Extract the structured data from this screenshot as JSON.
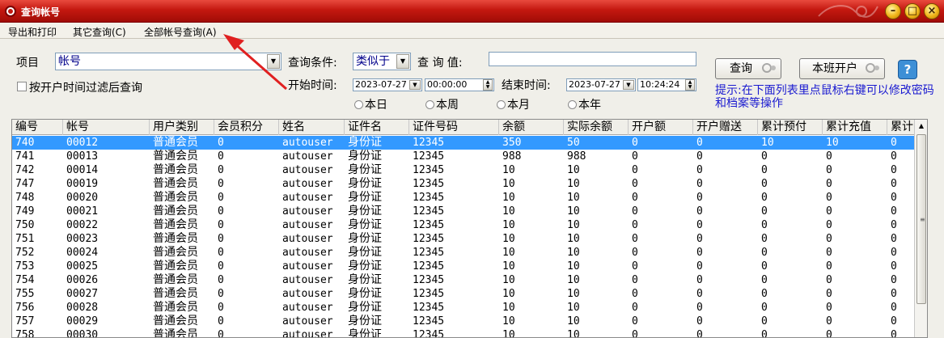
{
  "window": {
    "title": "查询帐号"
  },
  "menu": [
    "导出和打印",
    "其它查询(C)",
    "全部帐号查询(A)"
  ],
  "search": {
    "item_label": "项目",
    "item_value": "帐号",
    "condition_label": "查询条件:",
    "condition_value": "类似于",
    "query_value_label": "查 询 值:",
    "query_value": "",
    "filter_checkbox_label": "按开户时间过滤后查询",
    "start_time_label": "开始时间:",
    "start_date": "2023-07-27",
    "start_time": "00:00:00",
    "end_time_label": "结束时间:",
    "end_date": "2023-07-27",
    "end_time": "10:24:24",
    "ranges": [
      "本日",
      "本周",
      "本月",
      "本年"
    ]
  },
  "buttons": {
    "query": "查询",
    "open_shift": "本班开户",
    "help": "?"
  },
  "hint": "提示:在下面列表里点鼠标右键可以修改密码和档案等操作",
  "table": {
    "columns": [
      "编号",
      "帐号",
      "用户类别",
      "会员积分",
      "姓名",
      "证件名",
      "证件号码",
      "余额",
      "实际余额",
      "开户额",
      "开户赠送",
      "累计预付",
      "累计充值",
      "累计"
    ],
    "rows": [
      [
        "740",
        "00012",
        "普通会员",
        "0",
        "autouser",
        "身份证",
        "12345",
        "350",
        "50",
        "0",
        "0",
        "10",
        "10",
        "0"
      ],
      [
        "741",
        "00013",
        "普通会员",
        "0",
        "autouser",
        "身份证",
        "12345",
        "988",
        "988",
        "0",
        "0",
        "0",
        "0",
        "0"
      ],
      [
        "742",
        "00014",
        "普通会员",
        "0",
        "autouser",
        "身份证",
        "12345",
        "10",
        "10",
        "0",
        "0",
        "0",
        "0",
        "0"
      ],
      [
        "747",
        "00019",
        "普通会员",
        "0",
        "autouser",
        "身份证",
        "12345",
        "10",
        "10",
        "0",
        "0",
        "0",
        "0",
        "0"
      ],
      [
        "748",
        "00020",
        "普通会员",
        "0",
        "autouser",
        "身份证",
        "12345",
        "10",
        "10",
        "0",
        "0",
        "0",
        "0",
        "0"
      ],
      [
        "749",
        "00021",
        "普通会员",
        "0",
        "autouser",
        "身份证",
        "12345",
        "10",
        "10",
        "0",
        "0",
        "0",
        "0",
        "0"
      ],
      [
        "750",
        "00022",
        "普通会员",
        "0",
        "autouser",
        "身份证",
        "12345",
        "10",
        "10",
        "0",
        "0",
        "0",
        "0",
        "0"
      ],
      [
        "751",
        "00023",
        "普通会员",
        "0",
        "autouser",
        "身份证",
        "12345",
        "10",
        "10",
        "0",
        "0",
        "0",
        "0",
        "0"
      ],
      [
        "752",
        "00024",
        "普通会员",
        "0",
        "autouser",
        "身份证",
        "12345",
        "10",
        "10",
        "0",
        "0",
        "0",
        "0",
        "0"
      ],
      [
        "753",
        "00025",
        "普通会员",
        "0",
        "autouser",
        "身份证",
        "12345",
        "10",
        "10",
        "0",
        "0",
        "0",
        "0",
        "0"
      ],
      [
        "754",
        "00026",
        "普通会员",
        "0",
        "autouser",
        "身份证",
        "12345",
        "10",
        "10",
        "0",
        "0",
        "0",
        "0",
        "0"
      ],
      [
        "755",
        "00027",
        "普通会员",
        "0",
        "autouser",
        "身份证",
        "12345",
        "10",
        "10",
        "0",
        "0",
        "0",
        "0",
        "0"
      ],
      [
        "756",
        "00028",
        "普通会员",
        "0",
        "autouser",
        "身份证",
        "12345",
        "10",
        "10",
        "0",
        "0",
        "0",
        "0",
        "0"
      ],
      [
        "757",
        "00029",
        "普通会员",
        "0",
        "autouser",
        "身份证",
        "12345",
        "10",
        "10",
        "0",
        "0",
        "0",
        "0",
        "0"
      ],
      [
        "758",
        "00030",
        "普通会员",
        "0",
        "autouser",
        "身份证",
        "12345",
        "10",
        "10",
        "0",
        "0",
        "0",
        "0",
        "0"
      ]
    ],
    "selected_row": 0
  },
  "colors": {
    "title_bar": "#c41810",
    "selection": "#3399ff",
    "hint_text": "#1a1ad0",
    "annotation_arrow": "#e02020"
  }
}
